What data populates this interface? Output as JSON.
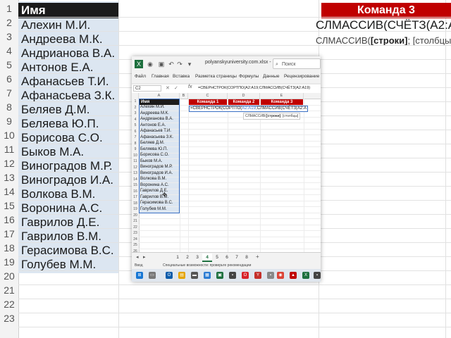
{
  "background": {
    "row_numbers": [
      "1",
      "2",
      "3",
      "4",
      "5",
      "6",
      "7",
      "8",
      "9",
      "10",
      "11",
      "12",
      "13",
      "14",
      "15",
      "16",
      "17",
      "18",
      "19",
      "20",
      "21",
      "22",
      "23"
    ],
    "header": "Имя",
    "names": [
      "Алехин М.И.",
      "Андреева М.К.",
      "Андрианова В.А.",
      "Антонов Е.А.",
      "Афанасьев Т.И.",
      "Афанасьева З.К.",
      "Беляев Д.М.",
      "Беляева Ю.П.",
      "Борисова С.О.",
      "Быков М.А.",
      "Виноградов М.Р.",
      "Виноградов И.А.",
      "Волкова В.М.",
      "Воронина А.С.",
      "Гаврилов Д.Е.",
      "Гаврилов В.М.",
      "Герасимова В.С.",
      "Голубев М.М."
    ],
    "command3": "Команда 3",
    "formula_fragment": "СЛМАССИВ(СЧЁТЗ(A2:A1",
    "tooltip_prefix": "СЛМАССИВ(",
    "tooltip_bold": "[строки]",
    "tooltip_rest": "; [столбцы];"
  },
  "window": {
    "file_title": "polyanskyuniversity.com.xlsx  -  E...",
    "search_placeholder": "Поиск",
    "menu": [
      "Файл",
      "Главная",
      "Вставка",
      "Разметка страницы",
      "Формулы",
      "Данные",
      "Рецензирование"
    ],
    "name_box": "C2",
    "fx": "fx",
    "formula": "=СВЕРНСТРОК(СОРТПО(A2:A19;СЛМАССИВ(СЧЁТЗ(A2:A19)",
    "columns": [
      "A",
      "B",
      "C",
      "D",
      "E"
    ],
    "row_numbers": [
      "1",
      "2",
      "3",
      "4",
      "5",
      "6",
      "7",
      "8",
      "9",
      "10",
      "11",
      "12",
      "13",
      "14",
      "15",
      "16",
      "17",
      "18",
      "19",
      "20",
      "21",
      "22",
      "23",
      "24",
      "25",
      "26"
    ],
    "header": "Имя",
    "names": [
      "Алехин М.И.",
      "Андреева М.К.",
      "Андрианова В.А.",
      "Антонов Е.А.",
      "Афанасьев Т.И.",
      "Афанасьева З.К.",
      "Беляев Д.М.",
      "Беляева Ю.П.",
      "Борисова С.О.",
      "Быков М.А.",
      "Виноградов М.Р.",
      "Виноградов И.А.",
      "Волкова В.М.",
      "Воронина А.С.",
      "Гаврилов Д.Е.",
      "Гаврилов В.М.",
      "Герасимова В.С.",
      "Голубев М.М."
    ],
    "commands": [
      "Команда 1",
      "Команда 2",
      "Команда 3"
    ],
    "cell_formula_prefix": "=СВЕРНСТРОК(СОРТПО(",
    "cell_formula_ref": "A2:A19",
    "cell_formula_rest": ";СЛМАССИВ(СЧЁТЗ(A2:A",
    "cell_tip_prefix": "СЛМАССИВ(",
    "cell_tip_bold": "[строки]",
    "cell_tip_rest": "; [столбцы]",
    "sheet_tabs": [
      "1",
      "2",
      "3",
      "4",
      "5",
      "6",
      "7",
      "8"
    ],
    "active_tab": "4",
    "status_mode": "Ввод",
    "status_accessibility": "Специальные возможности: проверьте рекомендации"
  },
  "colors": {
    "command_red": "#c00000",
    "selection_blue": "#dce6f1",
    "excel_green": "#1d6f3e"
  }
}
